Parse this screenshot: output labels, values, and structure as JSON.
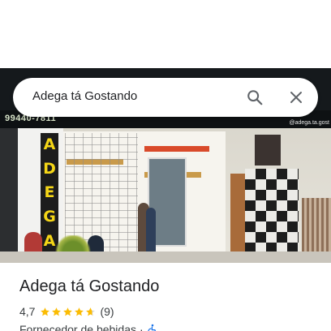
{
  "search": {
    "query": "Adega tá Gostando"
  },
  "photo": {
    "phone_text": "99440-7811",
    "handle_text": "@adega.ta.gost",
    "sign_letters": [
      "A",
      "D",
      "E",
      "G",
      "A"
    ]
  },
  "place": {
    "name": "Adega tá Gostando",
    "rating": "4,7",
    "rating_value": 4.7,
    "review_count": "(9)",
    "category": "Fornecedor de bebidas",
    "separator": "·"
  },
  "colors": {
    "star": "#fbbc04",
    "star_empty": "#dadce0",
    "icon": "#5f6368",
    "accessibility": "#1a73e8",
    "sign_yellow": "#f5d617"
  },
  "icons": {
    "search": "search-icon",
    "close": "close-icon",
    "accessibility": "wheelchair-icon"
  }
}
